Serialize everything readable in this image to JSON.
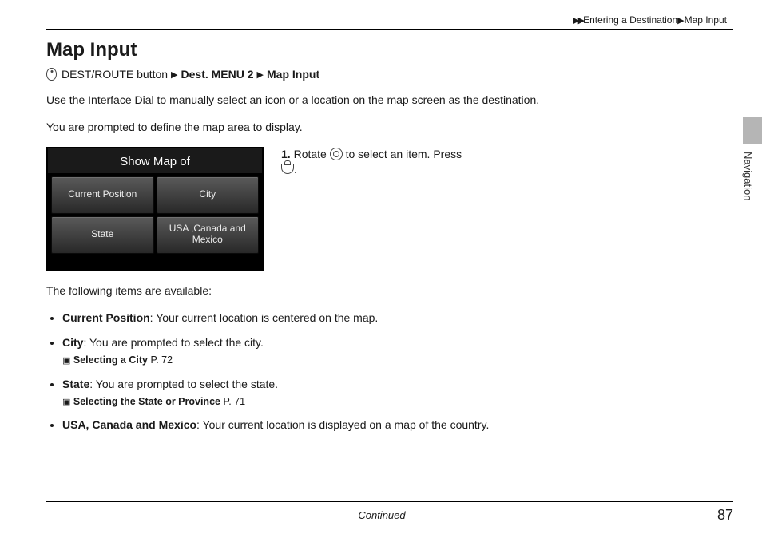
{
  "breadcrumb": {
    "part1": "Entering a Destination",
    "part2": "Map Input"
  },
  "title": "Map Input",
  "nav_steps": {
    "source": "DEST/ROUTE button",
    "step2": "Dest. MENU 2",
    "step3": "Map Input"
  },
  "intro": "Use the Interface Dial to manually select an icon or a location on the map screen as the destination.",
  "prompt": "You are prompted to define the map area to display.",
  "screen": {
    "title": "Show Map of",
    "buttons": {
      "tl": "Current Position",
      "tr": "City",
      "bl": "State",
      "br": "USA ,Canada and Mexico"
    }
  },
  "instruction": {
    "num": "1.",
    "rotate": "Rotate",
    "select": "to select an item. Press",
    "end": "."
  },
  "available_label": "The following items are available:",
  "items": {
    "current_position": {
      "label": "Current Position",
      "desc": ": Your current location is centered on the map."
    },
    "city": {
      "label": "City",
      "desc": ": You are prompted to select the city.",
      "xref_label": "Selecting a City",
      "xref_page": "P. 72"
    },
    "state": {
      "label": "State",
      "desc": ": You are prompted to select the state.",
      "xref_label": "Selecting the State or Province",
      "xref_page": "P. 71"
    },
    "usa": {
      "label": "USA, Canada and Mexico",
      "desc": ": Your current location is displayed on a map of the country."
    }
  },
  "side_section": "Navigation",
  "footer": {
    "continued": "Continued",
    "page": "87"
  }
}
